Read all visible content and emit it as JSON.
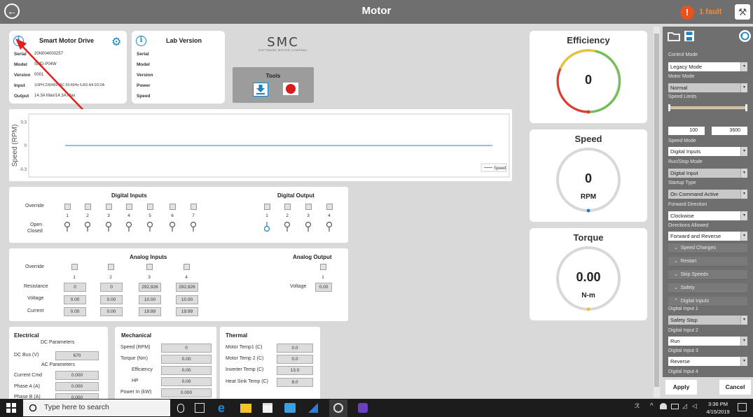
{
  "app": {
    "title": "Motor",
    "fault_label": "1 fault",
    "back_glyph": "←",
    "fault_glyph": "!",
    "wrench_glyph": "⚒",
    "info_glyph": "i",
    "gear_glyph": "⚙"
  },
  "drive_card": {
    "title": "Smart Motor Drive",
    "rows": [
      {
        "label": "Serial",
        "value": "20N004000257"
      },
      {
        "label": "Model",
        "value": "SMD-P04W"
      },
      {
        "label": "Version",
        "value": "0001"
      },
      {
        "label": "Input",
        "value": "1/3PH 230/400VAC 50-60Hz 6.8/3.4/4.0/2.0A"
      },
      {
        "label": "Output",
        "value": "14.3A Max/14.3A Max"
      }
    ]
  },
  "lab_card": {
    "title": "Lab Version",
    "rows": [
      {
        "label": "Serial"
      },
      {
        "label": "Model"
      },
      {
        "label": "Version"
      },
      {
        "label": "Power"
      },
      {
        "label": "Speed"
      }
    ]
  },
  "brand": {
    "logo": "SMC",
    "tagline": "SOFTWARE MOTOR COMPANY"
  },
  "tools": {
    "title": "Tools"
  },
  "chart_data": {
    "type": "line",
    "ylabel": "Speed (RPM)",
    "yticks": [
      "0.3",
      "0",
      "-0.3"
    ],
    "ylim": [
      -0.4,
      0.4
    ],
    "series": [
      {
        "name": "Speed",
        "values": [
          0,
          0
        ],
        "color": "#3aa0d8"
      }
    ],
    "legend": "bottom-right",
    "grid": false
  },
  "digital_inputs": {
    "title": "Digital Inputs",
    "override_label": "Override",
    "open_label": "Open",
    "closed_label": "Closed",
    "numbers": [
      "1",
      "2",
      "3",
      "4",
      "5",
      "6",
      "7"
    ]
  },
  "digital_output": {
    "title": "Digital Output",
    "numbers": [
      "1",
      "2",
      "3",
      "4"
    ]
  },
  "analog_inputs": {
    "title": "Analog Inputs",
    "override_label": "Override",
    "numbers": [
      "1",
      "2",
      "3",
      "4"
    ],
    "rows": [
      {
        "label": "Resistance",
        "values": [
          "0",
          "0",
          "292,926",
          "292,926"
        ]
      },
      {
        "label": "Voltage",
        "values": [
          "0.00",
          "0.00",
          "10.00",
          "10.00"
        ]
      },
      {
        "label": "Current",
        "values": [
          "0.00",
          "0.00",
          "19.99",
          "19.99"
        ]
      }
    ]
  },
  "analog_output": {
    "title": "Analog Output",
    "number": "1",
    "voltage_label": "Voltage",
    "voltage_value": "0.00"
  },
  "electrical": {
    "title": "Electrical",
    "dc_params_title": "DC Parameters",
    "dc_bus_label": "DC Bus (V)",
    "dc_bus_value": "670",
    "ac_params_title": "AC Parameters",
    "rows": [
      {
        "label": "Current Cmd",
        "value": "0.000"
      },
      {
        "label": "Phase A (A)",
        "value": "0.000"
      },
      {
        "label": "Phase B (A)",
        "value": "0.000"
      }
    ]
  },
  "mechanical": {
    "title": "Mechanical",
    "rows": [
      {
        "label": "Speed (RPM)",
        "value": "0"
      },
      {
        "label": "Torque (Nm)",
        "value": "0.00"
      },
      {
        "label": "Efficiency",
        "value": "0.00"
      },
      {
        "label": "HP",
        "value": "0.00"
      },
      {
        "label": "Power In (kW)",
        "value": "0.000"
      }
    ]
  },
  "thermal": {
    "title": "Thermal",
    "rows": [
      {
        "label": "Motor Temp1 (C)",
        "value": "0.0"
      },
      {
        "label": "Motor Temp 2 (C)",
        "value": "0.0"
      },
      {
        "label": "Inverter Temp (C)",
        "value": "13.0"
      },
      {
        "label": "Heat Sink Temp (C)",
        "value": "8.0"
      }
    ]
  },
  "gauges": {
    "efficiency": {
      "title": "Efficiency",
      "value": "0",
      "fraction": 0
    },
    "speed": {
      "title": "Speed",
      "value": "0",
      "unit": "RPM"
    },
    "torque": {
      "title": "Torque",
      "value": "0.00",
      "unit": "N-m"
    }
  },
  "settings": {
    "control_mode_label": "Control Mode",
    "control_mode": "Legacy Mode",
    "motor_mode_label": "Motor Mode",
    "motor_mode": "Normal",
    "speed_limits_label": "Speed Limits",
    "speed_min": "100",
    "speed_max": "3600",
    "speed_mode_label": "Speed Mode",
    "speed_mode": "Digital Inputs",
    "run_stop_label": "Run/Stop Mode",
    "run_stop": "Digital Input",
    "startup_label": "Startup Type",
    "startup": "On Command Active",
    "forward_label": "Forward Direction",
    "forward": "Clockwise",
    "directions_label": "Directions Allowed",
    "directions": "Forward and Reverse",
    "sections": [
      "Speed Changes",
      "Restart",
      "Skip Speeds",
      "Safety"
    ],
    "digital_inputs_section": "Digital Inputs",
    "di1_label": "Digital Input 1",
    "di1": "Safety Stop",
    "di2_label": "Digital Input 2",
    "di2": "Run",
    "di3_label": "Digital Input 3",
    "di3": "Reverse",
    "di4_label": "Digital Input 4",
    "apply_label": "Apply",
    "cancel_label": "Cancel"
  },
  "taskbar": {
    "search_placeholder": "Type here to search",
    "time": "3:36 PM",
    "date": "4/15/2019"
  }
}
